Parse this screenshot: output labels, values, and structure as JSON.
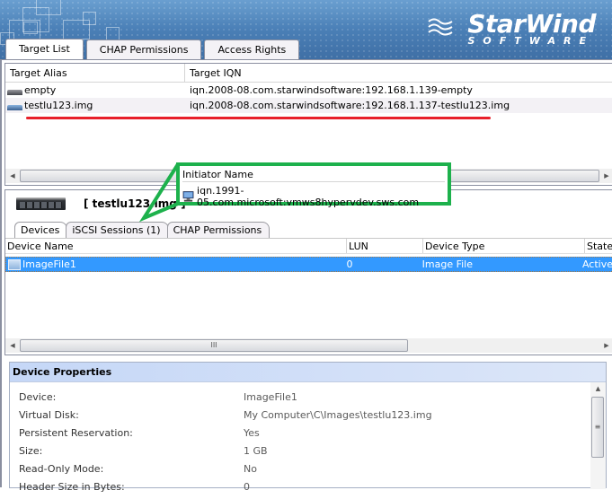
{
  "brand": {
    "name": "StarWind",
    "tagline": "SOFTWARE"
  },
  "main_tabs": [
    {
      "label": "Target List",
      "active": true
    },
    {
      "label": "CHAP Permissions",
      "active": false
    },
    {
      "label": "Access Rights",
      "active": false
    }
  ],
  "targets": {
    "columns": [
      "Target Alias",
      "Target IQN"
    ],
    "rows": [
      {
        "alias": "empty",
        "iqn": "iqn.2008-08.com.starwindsoftware:192.168.1.139-empty"
      },
      {
        "alias": "testlu123.img",
        "iqn": "iqn.2008-08.com.starwindsoftware:192.168.1.137-testlu123.img",
        "highlighted": true
      }
    ]
  },
  "selected_target": {
    "title": "[ testlu123.img ]"
  },
  "sub_tabs": [
    {
      "label": "Devices",
      "active": true
    },
    {
      "label": "iSCSI Sessions (1)",
      "active": false
    },
    {
      "label": "CHAP Permissions",
      "active": false
    }
  ],
  "devices": {
    "columns": [
      "Device Name",
      "LUN",
      "Device Type",
      "State"
    ],
    "rows": [
      {
        "name": "ImageFile1",
        "lun": "0",
        "type": "Image File",
        "state": "Active",
        "selected": true
      }
    ]
  },
  "callout": {
    "header": "Initiator Name",
    "value": "iqn.1991-05.com.microsoft:vmws8hypervdev.sws.com",
    "color": "#1db14c"
  },
  "annotation_color": "#e8202a",
  "device_properties": {
    "title": "Device Properties",
    "rows": [
      {
        "key": "Device:",
        "value": "ImageFile1"
      },
      {
        "key": "Virtual Disk:",
        "value": "My Computer\\C\\Images\\testlu123.img"
      },
      {
        "key": "Persistent Reservation:",
        "value": "Yes"
      },
      {
        "key": "Size:",
        "value": "1 GB"
      },
      {
        "key": "Read-Only Mode:",
        "value": "No"
      },
      {
        "key": "Header Size in Bytes:",
        "value": "0"
      }
    ]
  },
  "scroll_glyphs": {
    "left": "◀",
    "right": "▶",
    "grip": "III",
    "up": "▲",
    "vgrip": "≡"
  }
}
